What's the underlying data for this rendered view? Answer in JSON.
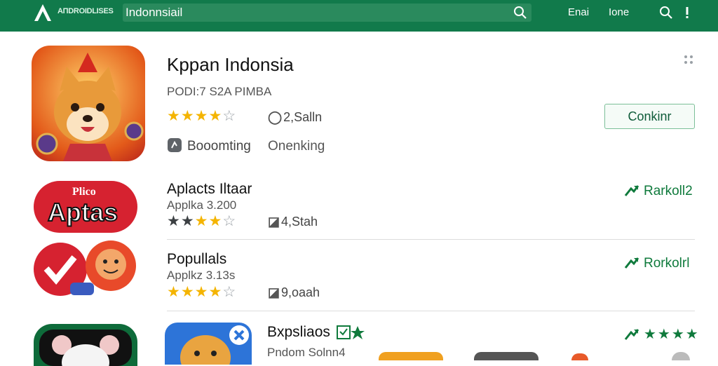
{
  "header": {
    "brand": "AΠDROIDLISES",
    "search_value": "Indonnsiail",
    "nav_email": "Enai",
    "nav_home": "Ione"
  },
  "featured": {
    "title": "Kppan Indonsia",
    "subtitle": "PODI:7 S2A PIMBA",
    "rating_count": "2,Salln",
    "tag_left": "Booomting",
    "tag_right": "Onenking",
    "button": "Conkinr"
  },
  "list": [
    {
      "name": "Aplacts Iltaar",
      "meta": "Applka 3.200",
      "count": "4,Stah",
      "action": "Rarkoll2",
      "icon_text": "Aptas",
      "icon_top_text": "Plico"
    },
    {
      "name": "Popullals",
      "meta": "Applkz 3.13s",
      "count": "9,oaah",
      "action": "Rorkolrl"
    },
    {
      "name": "Bxpsliaos",
      "meta": "Pndom Solnn4"
    }
  ],
  "colors": {
    "accent": "#117a4b",
    "star": "#f4b400",
    "action": "#0f7a3c"
  }
}
